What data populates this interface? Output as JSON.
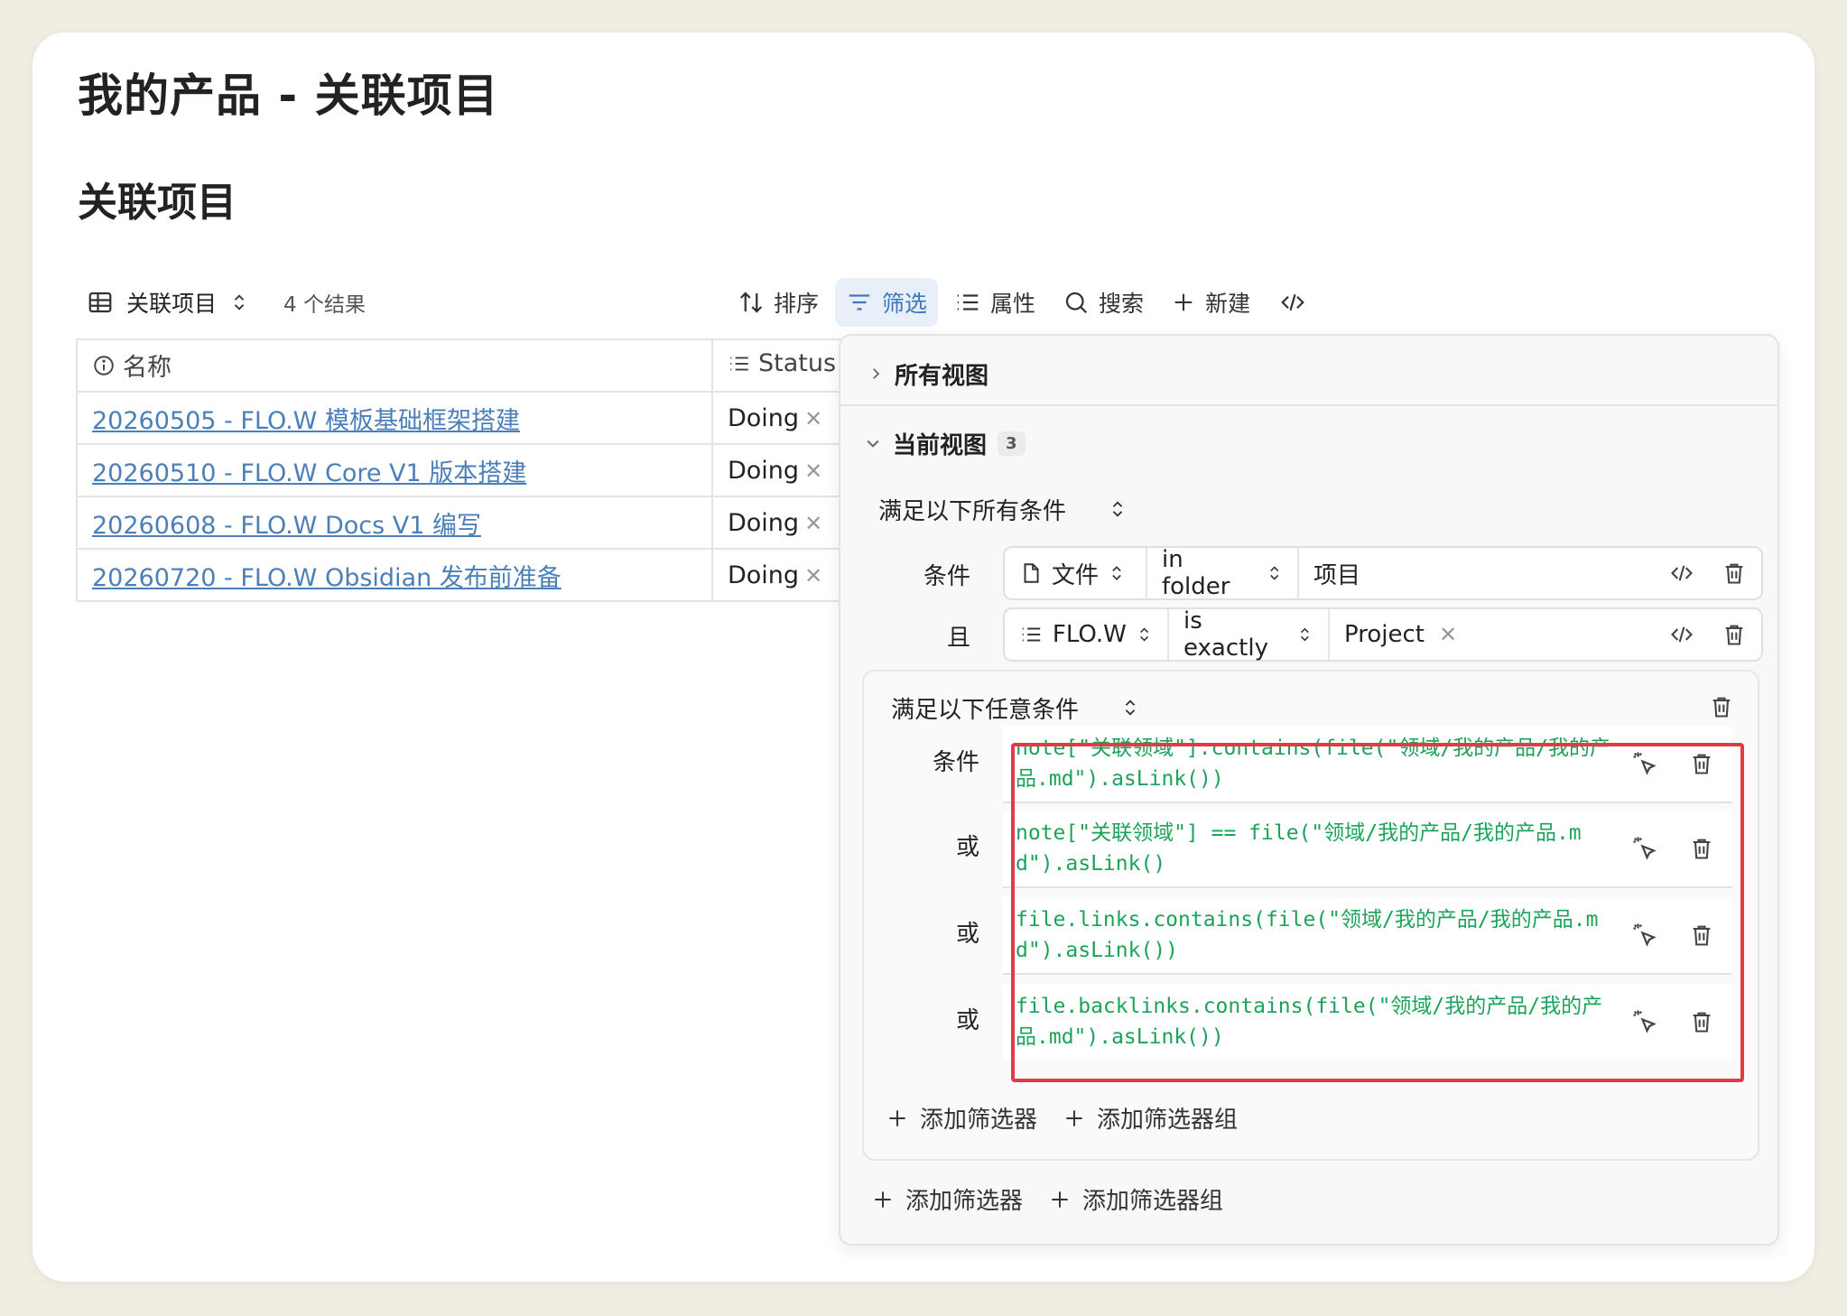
{
  "page": {
    "title": "我的产品 - 关联项目",
    "section": "关联项目"
  },
  "view": {
    "name": "关联项目",
    "count": "4 个结果"
  },
  "toolbar": {
    "sort": "排序",
    "filter": "筛选",
    "properties": "属性",
    "search": "搜索",
    "new": "新建"
  },
  "table": {
    "headers": {
      "name": "名称",
      "status": "Status"
    },
    "rows": [
      {
        "name": "20260505 - FLO.W 模板基础框架搭建",
        "status": "Doing"
      },
      {
        "name": "20260510 - FLO.W Core V1 版本搭建",
        "status": "Doing"
      },
      {
        "name": "20260608 - FLO.W Docs V1 编写",
        "status": "Doing"
      },
      {
        "name": "20260720 - FLO.W Obsidian 发布前准备",
        "status": "Doing"
      }
    ]
  },
  "filter_panel": {
    "all_views": "所有视图",
    "current_view": "当前视图",
    "current_count": "3",
    "match_all": "满足以下所有条件",
    "rows": [
      {
        "label": "条件",
        "property": "文件",
        "operator": "in folder",
        "value": "项目"
      },
      {
        "label": "且",
        "property": "FLO.W",
        "operator": "is exactly",
        "value": "Project"
      }
    ],
    "group": {
      "match_any": "满足以下任意条件",
      "conditions": [
        {
          "label": "条件",
          "code": "note[\"关联领域\"].contains(file(\"领域/我的产品/我的产品.md\").asLink())"
        },
        {
          "label": "或",
          "code": "note[\"关联领域\"] == file(\"领域/我的产品/我的产品.md\").asLink()"
        },
        {
          "label": "或",
          "code": "file.links.contains(file(\"领域/我的产品/我的产品.md\").asLink())"
        },
        {
          "label": "或",
          "code": "file.backlinks.contains(file(\"领域/我的产品/我的产品.md\").asLink())"
        }
      ],
      "add_filter": "添加筛选器",
      "add_group": "添加筛选器组"
    },
    "add_filter": "添加筛选器",
    "add_group": "添加筛选器组"
  },
  "colors": {
    "link": "#4c7fb8",
    "code": "#1ba35a",
    "highlight": "#e23b48",
    "active_bg": "#e8eff8"
  }
}
